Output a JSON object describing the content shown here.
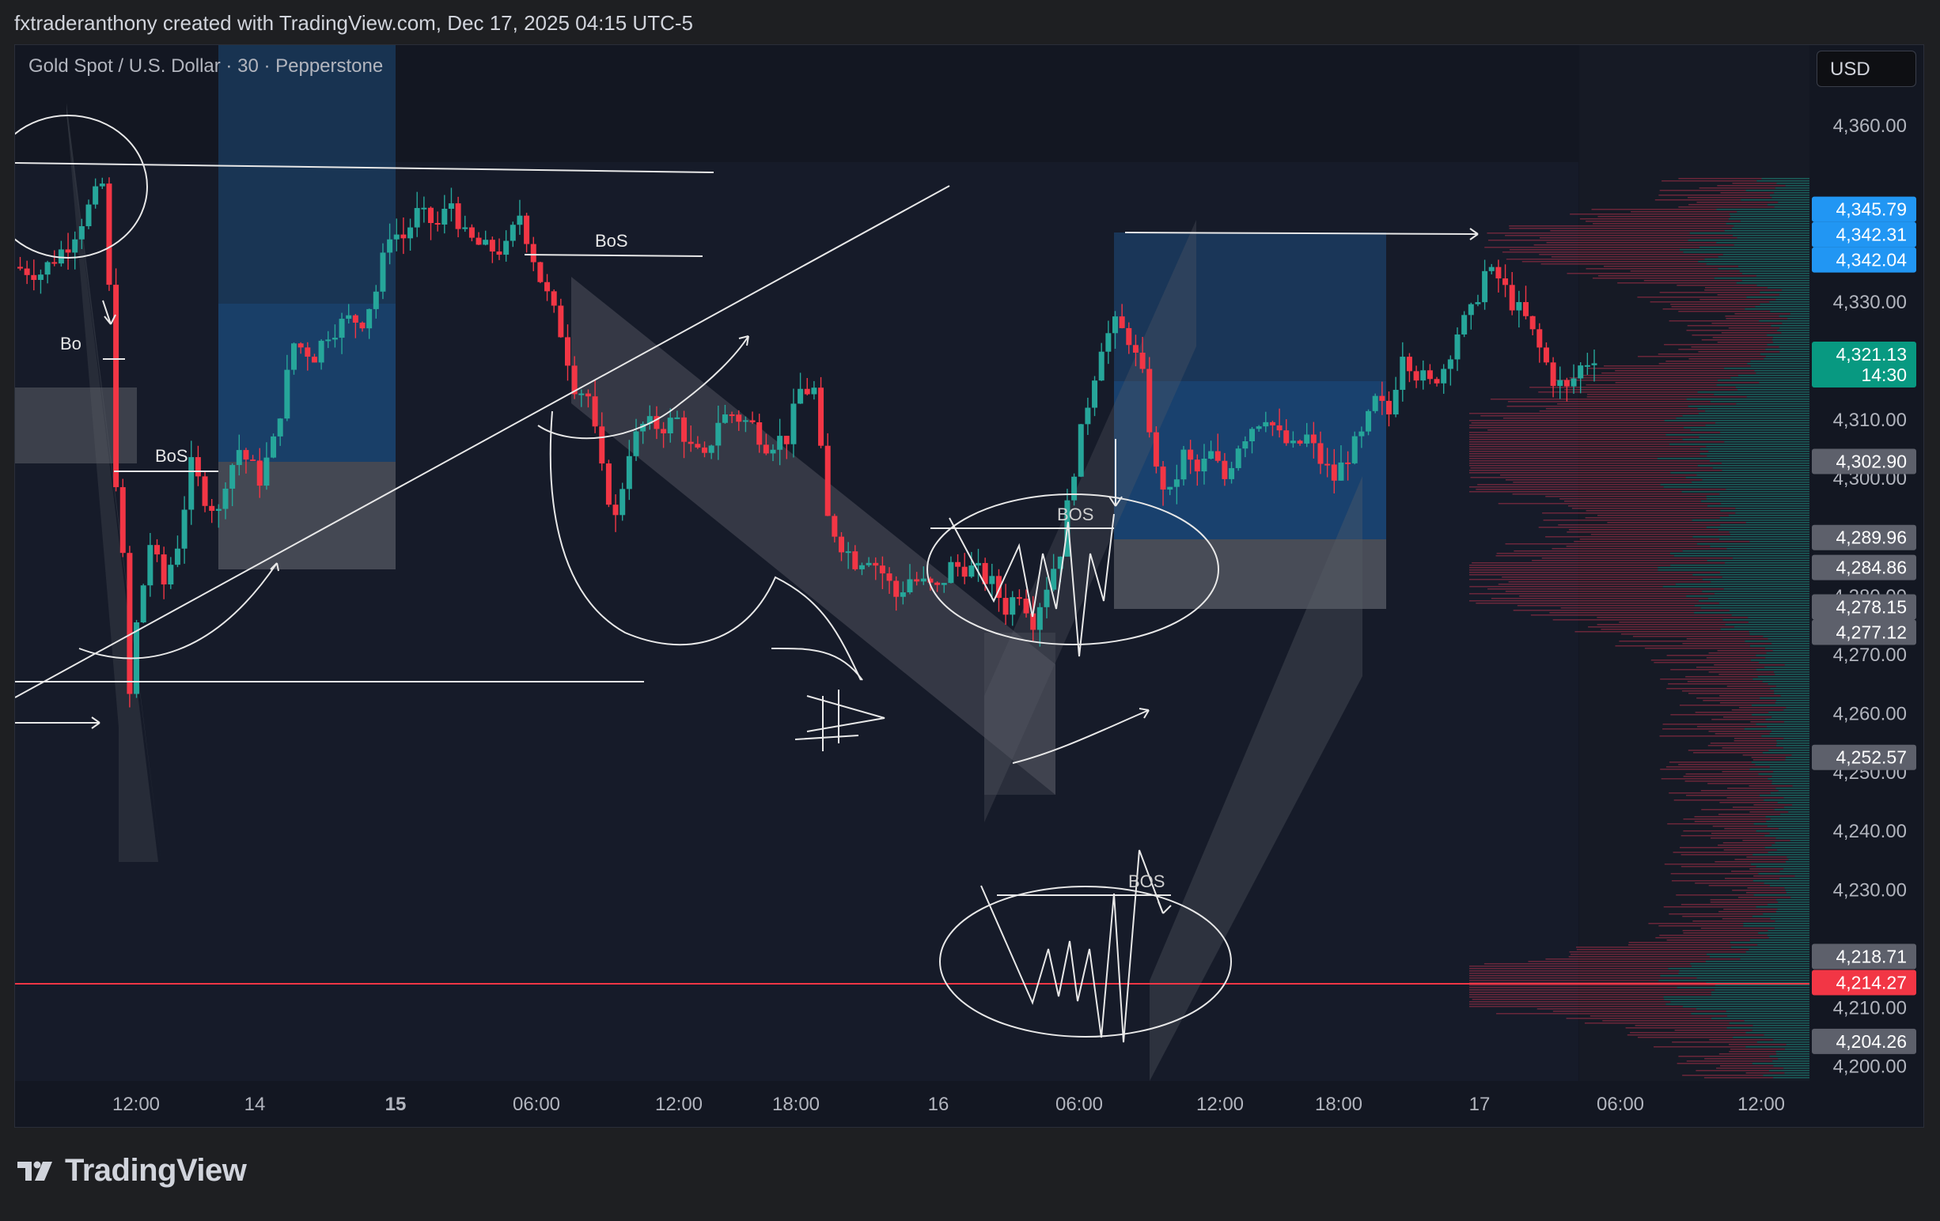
{
  "header": {
    "credit": "fxtraderanthony created with TradingView.com, Dec 17, 2025 04:15 UTC-5"
  },
  "symbol": {
    "title": "Gold Spot / U.S. Dollar · 30 · Pepperstone"
  },
  "currency_button": "USD",
  "brand": "TradingView",
  "colors": {
    "up": "#26a69a",
    "down": "#f23645",
    "background": "#131722",
    "current_price": "#089981",
    "alert_line": "#f23645",
    "highlight_blue": "#2196f3"
  },
  "annotations": {
    "bos_1": "BoS",
    "bos_2": "BoS",
    "bos_3": "BOS",
    "bos_4": "BOS",
    "bo_cut": "Bo"
  },
  "chart_data": {
    "type": "candlestick",
    "ylim": [
      4198,
      4369
    ],
    "y_ticks": [
      "4,360.00",
      "4,330.00",
      "4,310.00",
      "4,300.00",
      "4,280.00",
      "4,270.00",
      "4,260.00",
      "4,250.00",
      "4,240.00",
      "4,230.00",
      "4,210.00",
      "4,200.00"
    ],
    "x_ticks": [
      "12:00",
      "14",
      "15",
      "06:00",
      "12:00",
      "18:00",
      "16",
      "06:00",
      "12:00",
      "18:00",
      "17",
      "06:00",
      "12:00"
    ],
    "price_labels": [
      {
        "text": "4,345.79",
        "value": 4345.79,
        "style": "blue"
      },
      {
        "text": "4,342.31",
        "value": 4342.31,
        "style": "blue"
      },
      {
        "text": "4,342.04",
        "value": 4342.04,
        "style": "blue"
      },
      {
        "text": "4,321.13",
        "value": 4321.13,
        "style": "green"
      },
      {
        "text": "4,302.90",
        "value": 4302.9,
        "style": "gray"
      },
      {
        "text": "4,289.96",
        "value": 4289.96,
        "style": "gray"
      },
      {
        "text": "4,284.86",
        "value": 4284.86,
        "style": "gray"
      },
      {
        "text": "4,278.15",
        "value": 4278.15,
        "style": "gray"
      },
      {
        "text": "4,277.12",
        "value": 4277.12,
        "style": "gray"
      },
      {
        "text": "4,252.57",
        "value": 4252.57,
        "style": "gray"
      },
      {
        "text": "4,218.71",
        "value": 4218.71,
        "style": "gray"
      },
      {
        "text": "4,214.27",
        "value": 4214.27,
        "style": "red"
      },
      {
        "text": "4,204.26",
        "value": 4204.26,
        "style": "gray"
      }
    ],
    "countdown": "14:30",
    "path_points": [
      [
        0,
        4336
      ],
      [
        4,
        4335
      ],
      [
        8,
        4340
      ],
      [
        11,
        4346
      ],
      [
        13,
        4350
      ],
      [
        14,
        4332
      ],
      [
        15,
        4300
      ],
      [
        16,
        4286
      ],
      [
        17,
        4263
      ],
      [
        18,
        4275
      ],
      [
        20,
        4289
      ],
      [
        22,
        4282
      ],
      [
        24,
        4289
      ],
      [
        26,
        4302
      ],
      [
        28,
        4297
      ],
      [
        30,
        4294
      ],
      [
        31,
        4300
      ],
      [
        33,
        4305
      ],
      [
        36,
        4300
      ],
      [
        38,
        4306
      ],
      [
        41,
        4323
      ],
      [
        44,
        4321
      ],
      [
        46,
        4325
      ],
      [
        49,
        4327
      ],
      [
        51,
        4327
      ],
      [
        53,
        4332
      ],
      [
        55,
        4342
      ],
      [
        57,
        4341
      ],
      [
        59,
        4345
      ],
      [
        62,
        4343
      ],
      [
        64,
        4347
      ],
      [
        66,
        4341
      ],
      [
        69,
        4339
      ],
      [
        72,
        4339
      ],
      [
        74,
        4345
      ],
      [
        77,
        4334
      ],
      [
        80,
        4325
      ],
      [
        82,
        4316
      ],
      [
        84,
        4314
      ],
      [
        86,
        4301
      ],
      [
        88,
        4293
      ],
      [
        90,
        4305
      ],
      [
        92,
        4309
      ],
      [
        95,
        4309
      ],
      [
        97,
        4310
      ],
      [
        99,
        4305
      ],
      [
        101,
        4303
      ],
      [
        103,
        4310
      ],
      [
        105,
        4311
      ],
      [
        108,
        4309
      ],
      [
        110,
        4306
      ],
      [
        113,
        4307
      ],
      [
        115,
        4315
      ],
      [
        117,
        4315
      ],
      [
        119,
        4293
      ],
      [
        121,
        4289
      ],
      [
        123,
        4286
      ],
      [
        125,
        4287
      ],
      [
        127,
        4284
      ],
      [
        129,
        4280
      ],
      [
        131,
        4283
      ],
      [
        133,
        4282
      ],
      [
        135,
        4281
      ],
      [
        137,
        4285
      ],
      [
        139,
        4285
      ],
      [
        141,
        4284
      ],
      [
        143,
        4282
      ],
      [
        145,
        4278
      ],
      [
        147,
        4281
      ],
      [
        149,
        4276
      ],
      [
        151,
        4282
      ],
      [
        153,
        4288
      ],
      [
        155,
        4302
      ],
      [
        157,
        4313
      ],
      [
        159,
        4323
      ],
      [
        161,
        4326
      ],
      [
        163,
        4324
      ],
      [
        165,
        4317
      ],
      [
        167,
        4301
      ],
      [
        169,
        4297
      ],
      [
        171,
        4304
      ],
      [
        173,
        4301
      ],
      [
        175,
        4304
      ],
      [
        177,
        4300
      ],
      [
        179,
        4306
      ],
      [
        181,
        4309
      ],
      [
        183,
        4311
      ],
      [
        185,
        4307
      ],
      [
        187,
        4305
      ],
      [
        189,
        4307
      ],
      [
        191,
        4303
      ],
      [
        193,
        4300
      ],
      [
        195,
        4304
      ],
      [
        197,
        4307
      ],
      [
        199,
        4313
      ],
      [
        201,
        4311
      ],
      [
        203,
        4322
      ],
      [
        205,
        4318
      ],
      [
        207,
        4316
      ],
      [
        209,
        4319
      ],
      [
        211,
        4325
      ],
      [
        213,
        4328
      ],
      [
        215,
        4335
      ],
      [
        217,
        4334
      ],
      [
        219,
        4330
      ],
      [
        221,
        4327
      ],
      [
        223,
        4322
      ],
      [
        225,
        4317
      ],
      [
        227,
        4315
      ],
      [
        229,
        4319
      ],
      [
        231,
        4321
      ]
    ]
  }
}
